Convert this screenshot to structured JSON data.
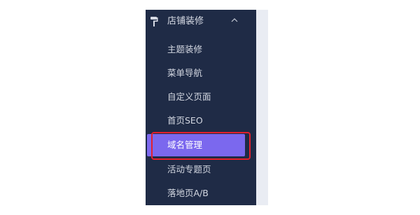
{
  "sidebar": {
    "section": {
      "label": "店铺装修",
      "icon": "paint-roller-icon",
      "expanded_icon": "chevron-up-icon"
    },
    "items": [
      {
        "label": "主题装修",
        "active": false
      },
      {
        "label": "菜单导航",
        "active": false
      },
      {
        "label": "自定义页面",
        "active": false
      },
      {
        "label": "首页SEO",
        "active": false
      },
      {
        "label": "域名管理",
        "active": true
      },
      {
        "label": "活动专题页",
        "active": false
      },
      {
        "label": "落地页A/B",
        "active": false
      }
    ]
  },
  "colors": {
    "sidebar_bg": "#1f2b46",
    "active_bg": "#7b68ee",
    "highlight_border": "#e3202d",
    "text": "#d3d7e1"
  }
}
